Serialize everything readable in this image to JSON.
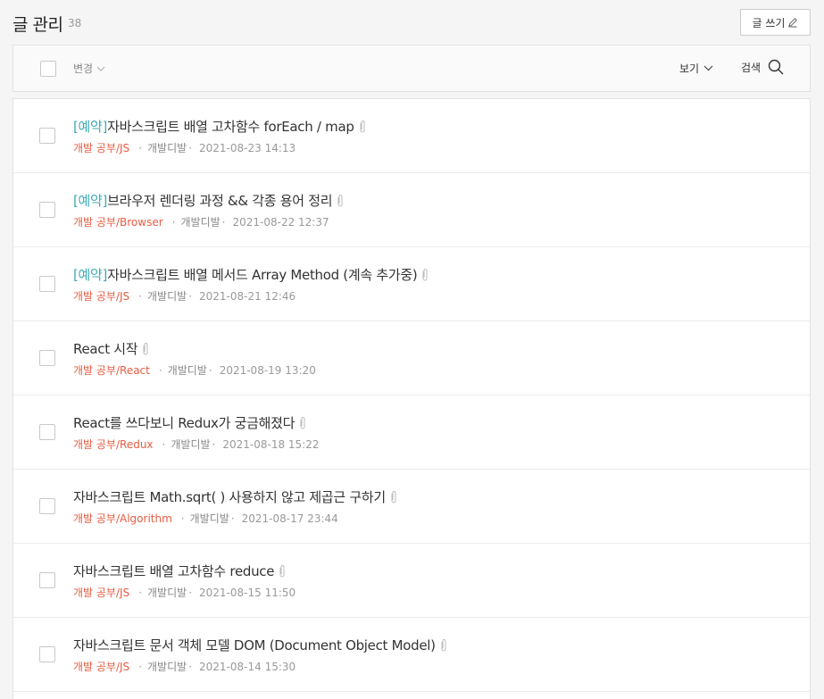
{
  "header": {
    "title": "글 관리",
    "count": "38",
    "write_label": "글 쓰기"
  },
  "toolbar": {
    "change_label": "변경",
    "view_label": "보기",
    "search_label": "검색"
  },
  "posts": [
    {
      "reserved": "[예약]",
      "title": "자바스크립트 배열 고차함수 forEach / map",
      "category": "개발 공부/JS",
      "author": "개발디발",
      "date": "2021-08-23 14:13"
    },
    {
      "reserved": "[예약]",
      "title": "브라우저 렌더링 과정 && 각종 용어 정리",
      "category": "개발 공부/Browser",
      "author": "개발디발",
      "date": "2021-08-22 12:37"
    },
    {
      "reserved": "[예약]",
      "title": "자바스크립트 배열 메서드 Array Method (계속 추가중)",
      "category": "개발 공부/JS",
      "author": "개발디발",
      "date": "2021-08-21 12:46"
    },
    {
      "reserved": "",
      "title": "React 시작",
      "category": "개발 공부/React",
      "author": "개발디발",
      "date": "2021-08-19 13:20"
    },
    {
      "reserved": "",
      "title": "React를 쓰다보니 Redux가 궁금해졌다",
      "category": "개발 공부/Redux",
      "author": "개발디발",
      "date": "2021-08-18 15:22"
    },
    {
      "reserved": "",
      "title": "자바스크립트 Math.sqrt( ) 사용하지 않고 제곱근 구하기",
      "category": "개발 공부/Algorithm",
      "author": "개발디발",
      "date": "2021-08-17 23:44"
    },
    {
      "reserved": "",
      "title": "자바스크립트 배열 고차함수 reduce",
      "category": "개발 공부/JS",
      "author": "개발디발",
      "date": "2021-08-15 11:50"
    },
    {
      "reserved": "",
      "title": "자바스크립트 문서 객체 모델 DOM (Document Object Model)",
      "category": "개발 공부/JS",
      "author": "개발디발",
      "date": "2021-08-14 15:30"
    }
  ]
}
